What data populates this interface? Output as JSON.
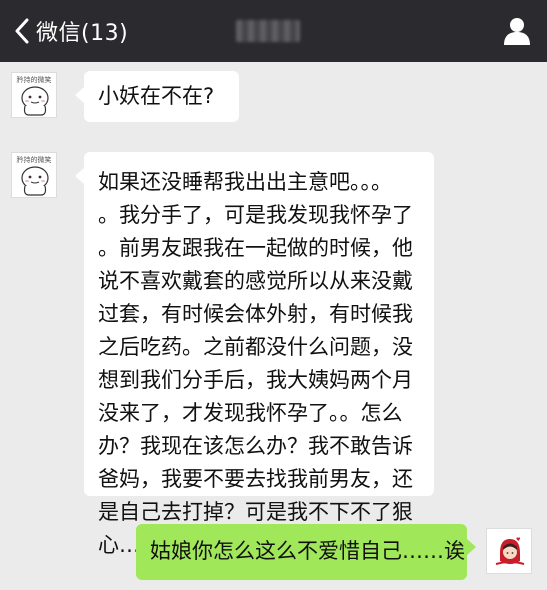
{
  "nav": {
    "back_label": "微信(13)",
    "title": ""
  },
  "contact": {
    "avatar_caption": "矜持的微笑"
  },
  "messages": [
    {
      "from": "contact",
      "text": "小妖在不在?"
    },
    {
      "from": "contact",
      "text": "如果还没睡帮我出出主意吧。。。\n。我分手了，可是我发现我怀孕了\n。前男友跟我在一起做的时候，他\n说不喜欢戴套的感觉所以从来没戴\n过套，有时候会体外射，有时候我\n之后吃药。之前都没什么问题，没\n想到我们分手后，我大姨妈两个月\n没来了，才发现我怀孕了。。怎么\n办？我现在该怎么办？我不敢告诉\n爸妈，我要不要去找我前男友，还\n是自己去打掉？可是我不下不了狠\n心………."
    },
    {
      "from": "me",
      "text": "姑娘你怎么这么不爱惜自己……诶"
    }
  ],
  "colors": {
    "topbar": "#2b2b2f",
    "background": "#ebebeb",
    "bubble_in": "#ffffff",
    "bubble_out": "#a0e75a"
  },
  "icons": {
    "back": "chevron-left-icon",
    "profile": "user-icon",
    "contact_avatar": "smiley-face-icon",
    "my_avatar": "red-hood-girl-icon"
  }
}
